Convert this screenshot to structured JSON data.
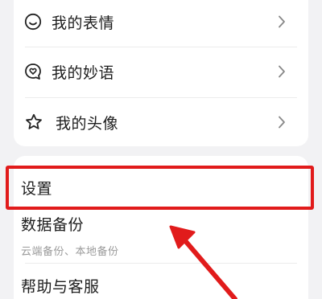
{
  "menu_top": {
    "items": [
      {
        "label": "我的表情",
        "icon": "emoji-face-icon"
      },
      {
        "label": "我的妙语",
        "icon": "heart-bubble-icon"
      },
      {
        "label": "我的头像",
        "icon": "star-icon"
      }
    ]
  },
  "menu_bottom": {
    "settings_label": "设置",
    "backup_label": "数据备份",
    "backup_sub": "云端备份、本地备份",
    "help_label": "帮助与客服"
  },
  "annotation": {
    "highlight_color": "#e11b1b"
  }
}
